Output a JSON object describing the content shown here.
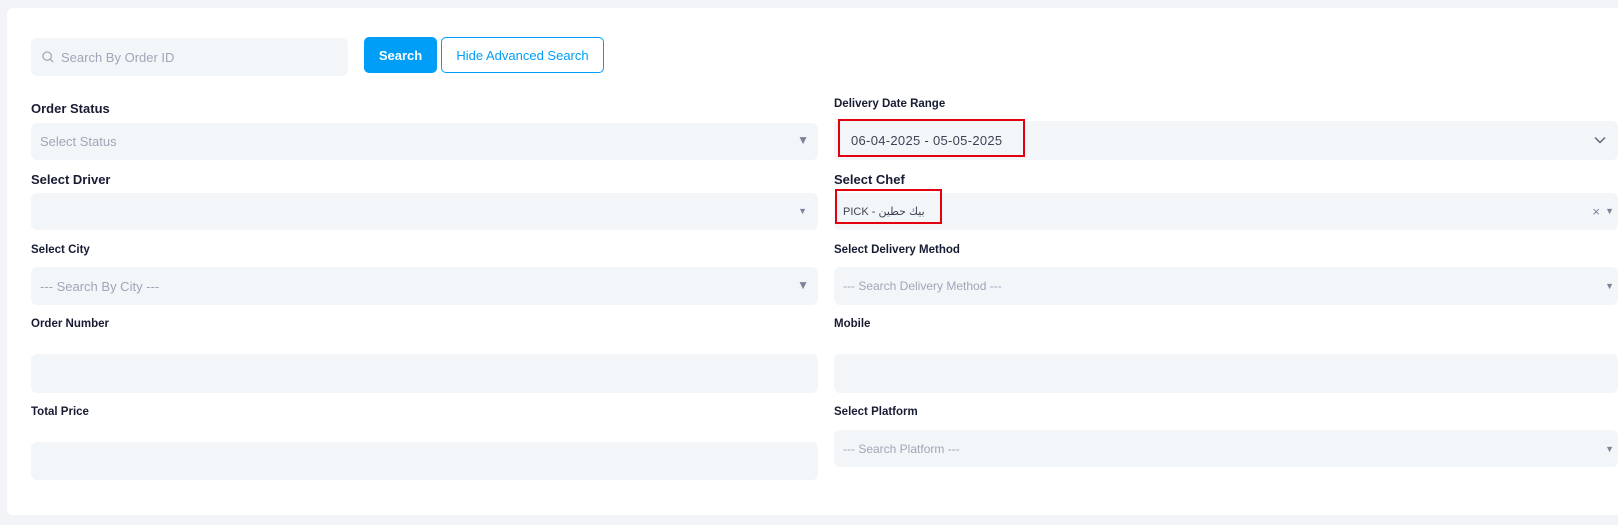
{
  "search": {
    "placeholder": "Search By Order ID",
    "search_button": "Search",
    "toggle_button": "Hide Advanced Search"
  },
  "filters": {
    "order_status": {
      "label": "Order Status",
      "placeholder": "Select Status"
    },
    "delivery_date_range": {
      "label": "Delivery Date Range",
      "value": "06-04-2025 - 05-05-2025"
    },
    "driver": {
      "label": "Select Driver",
      "value": ""
    },
    "chef": {
      "label": "Select Chef",
      "value": "PICK - بيك حطين",
      "clear_icon": "×"
    },
    "city": {
      "label": "Select City",
      "placeholder": "--- Search By City ---"
    },
    "delivery_method": {
      "label": "Select Delivery Method",
      "placeholder": "--- Search Delivery Method ---"
    },
    "order_number": {
      "label": "Order Number",
      "value": ""
    },
    "mobile": {
      "label": "Mobile",
      "value": ""
    },
    "total_price": {
      "label": "Total Price",
      "value": ""
    },
    "platform": {
      "label": "Select Platform",
      "placeholder": "--- Search Platform ---"
    }
  },
  "icons": {
    "search": "search-icon",
    "dropdown": "chevron-down-icon",
    "clear": "close-icon"
  },
  "colors": {
    "accent": "#009ef7",
    "field_bg": "#f3f6f9",
    "highlight": "#e3000f"
  }
}
